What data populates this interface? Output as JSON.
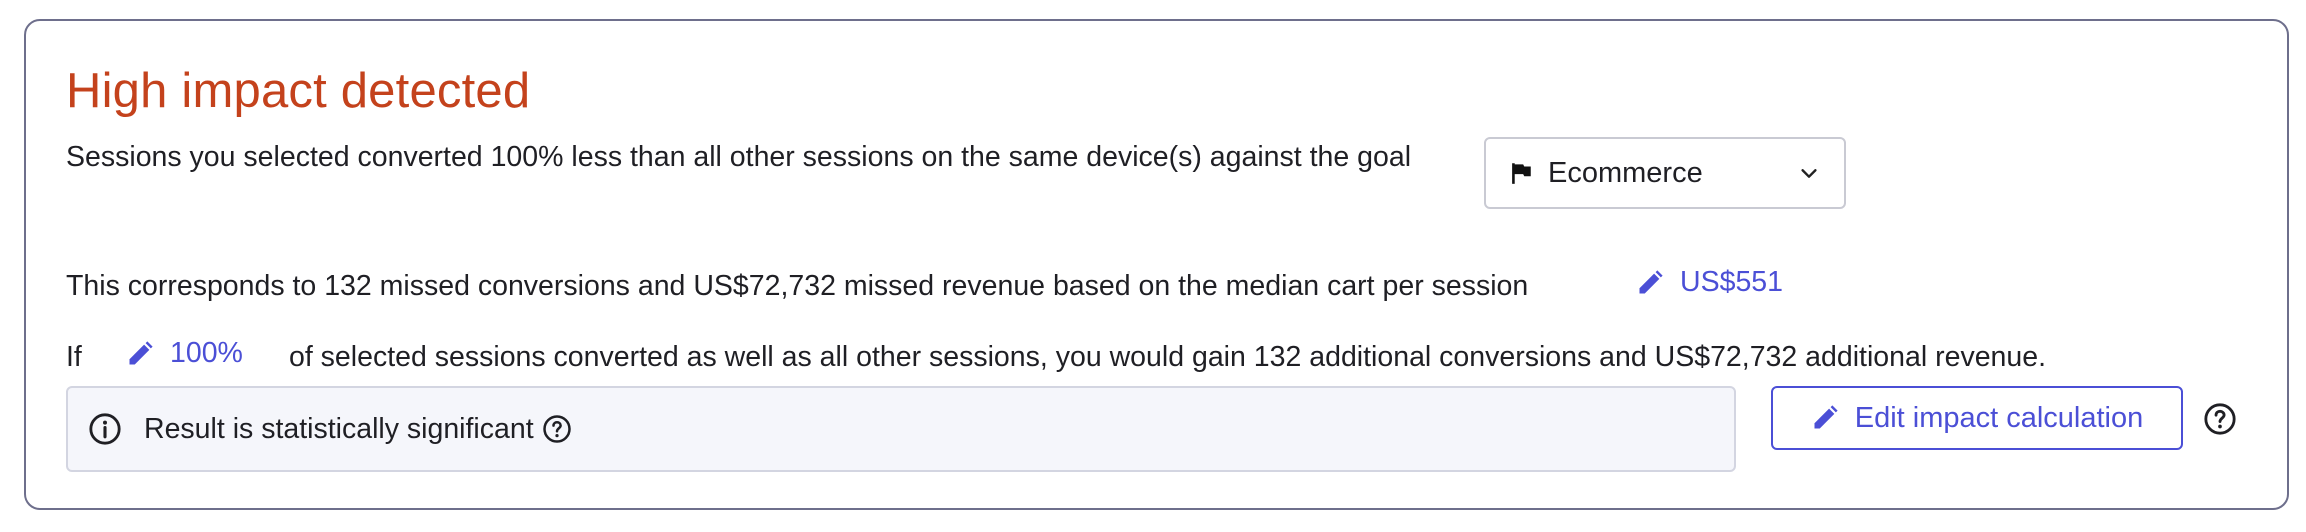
{
  "title": "High impact detected",
  "row1": {
    "text": "Sessions you selected converted 100% less than all other sessions on the same device(s) against the goal",
    "goal_select": {
      "value": "Ecommerce",
      "icon": "flag-icon"
    }
  },
  "row2": {
    "text": "This corresponds to 132 missed conversions and US$72,732 missed revenue based on the median cart per session",
    "median_value": "US$551"
  },
  "row3": {
    "if_text": "If",
    "percent_value": "100%",
    "rest_text": "of selected sessions converted as well as all other sessions, you would gain 132 additional conversions and US$72,732 additional revenue."
  },
  "significance": {
    "text": "Result is statistically significant"
  },
  "edit_button": {
    "label": "Edit impact calculation"
  },
  "colors": {
    "title": "#c4421c",
    "accent": "#4b4fd6",
    "card_border": "#6e6f8c",
    "sig_background": "#f5f6fb"
  }
}
